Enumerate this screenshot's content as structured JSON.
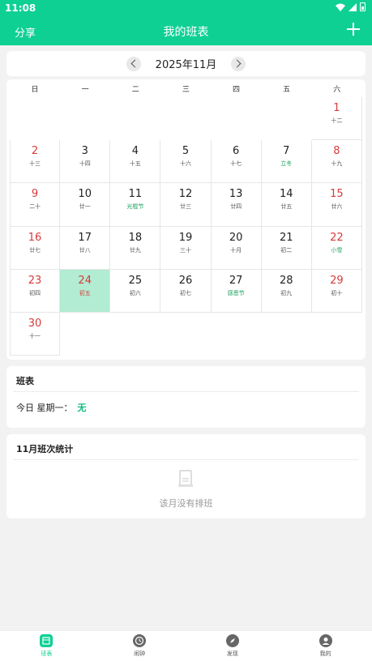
{
  "status_bar": {
    "time": "11:08"
  },
  "app_bar": {
    "share_label": "分享",
    "title": "我的班表",
    "add_icon": "plus-icon"
  },
  "month_nav": {
    "label": "2025年11月"
  },
  "calendar": {
    "weekdays": [
      "日",
      "一",
      "二",
      "三",
      "四",
      "五",
      "六"
    ],
    "days": [
      {
        "day": "1",
        "lunar": "十二"
      },
      {
        "day": "2",
        "lunar": "十三"
      },
      {
        "day": "3",
        "lunar": "十四"
      },
      {
        "day": "4",
        "lunar": "十五"
      },
      {
        "day": "5",
        "lunar": "十六"
      },
      {
        "day": "6",
        "lunar": "十七"
      },
      {
        "day": "7",
        "lunar": "立冬",
        "holiday": true
      },
      {
        "day": "8",
        "lunar": "十九"
      },
      {
        "day": "9",
        "lunar": "二十"
      },
      {
        "day": "10",
        "lunar": "廿一"
      },
      {
        "day": "11",
        "lunar": "光棍节",
        "holiday": true
      },
      {
        "day": "12",
        "lunar": "廿三"
      },
      {
        "day": "13",
        "lunar": "廿四"
      },
      {
        "day": "14",
        "lunar": "廿五"
      },
      {
        "day": "15",
        "lunar": "廿六"
      },
      {
        "day": "16",
        "lunar": "廿七"
      },
      {
        "day": "17",
        "lunar": "廿八"
      },
      {
        "day": "18",
        "lunar": "廿九"
      },
      {
        "day": "19",
        "lunar": "三十"
      },
      {
        "day": "20",
        "lunar": "十月"
      },
      {
        "day": "21",
        "lunar": "初二"
      },
      {
        "day": "22",
        "lunar": "小雪",
        "holiday": true
      },
      {
        "day": "23",
        "lunar": "初四"
      },
      {
        "day": "24",
        "lunar": "初五",
        "today": true
      },
      {
        "day": "25",
        "lunar": "初六"
      },
      {
        "day": "26",
        "lunar": "初七"
      },
      {
        "day": "27",
        "lunar": "感恩节",
        "holiday": true
      },
      {
        "day": "28",
        "lunar": "初九"
      },
      {
        "day": "29",
        "lunar": "初十"
      },
      {
        "day": "30",
        "lunar": "十一"
      }
    ],
    "first_weekday_index": 6
  },
  "schedule": {
    "title": "班表",
    "today_label": "今日 星期一：",
    "today_value": "无"
  },
  "stats": {
    "title": "11月班次统计",
    "empty_text": "该月没有排班"
  },
  "bottom_nav": {
    "items": [
      {
        "label": "班表",
        "icon": "calendar-icon",
        "active": true
      },
      {
        "label": "闹钟",
        "icon": "alarm-icon",
        "active": false
      },
      {
        "label": "发现",
        "icon": "compass-icon",
        "active": false
      },
      {
        "label": "我的",
        "icon": "profile-icon",
        "active": false
      }
    ]
  },
  "colors": {
    "accent": "#0fd093",
    "weekend": "#d63a3a",
    "holiday": "#19a05c",
    "today_bg": "#b2ecd2"
  }
}
